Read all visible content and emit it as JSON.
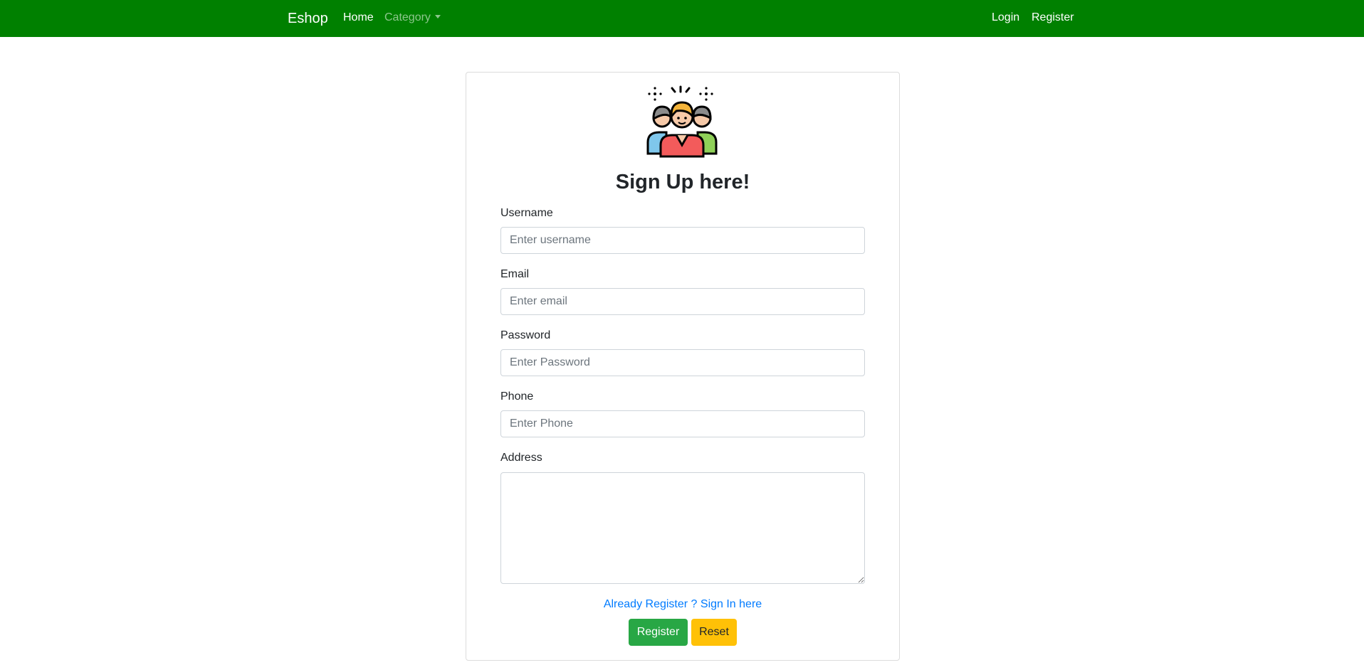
{
  "navbar": {
    "brand": "Eshop",
    "home": "Home",
    "category": "Category",
    "login": "Login",
    "register": "Register",
    "background_color": "#008000"
  },
  "form": {
    "icon": "group-people-icon",
    "title": "Sign Up here!",
    "username": {
      "label": "Username",
      "placeholder": "Enter username",
      "value": ""
    },
    "email": {
      "label": "Email",
      "placeholder": "Enter email",
      "value": ""
    },
    "password": {
      "label": "Password",
      "placeholder": "Enter Password",
      "value": ""
    },
    "phone": {
      "label": "Phone",
      "placeholder": "Enter Phone",
      "value": ""
    },
    "address": {
      "label": "Address",
      "value": ""
    },
    "signin_link": "Already Register ? Sign In here",
    "register_button": "Register",
    "reset_button": "Reset",
    "colors": {
      "register_button": "#28a745",
      "reset_button": "#ffc107",
      "link": "#007bff"
    }
  }
}
